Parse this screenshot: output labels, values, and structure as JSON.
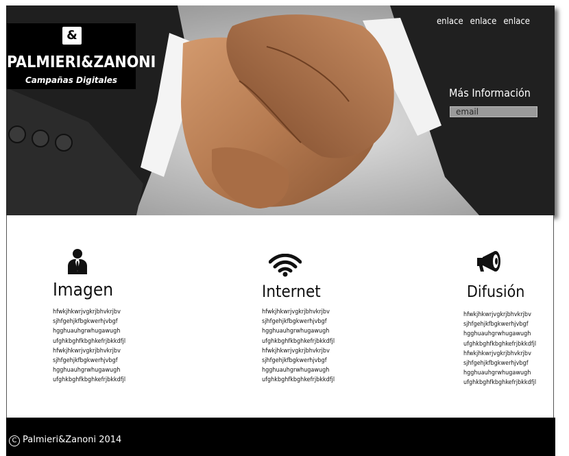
{
  "header": {
    "logo_symbol": "&",
    "brand_name": "PALMIERI&ZANONI",
    "tagline": "Campañas Digitales",
    "nav": [
      {
        "label": "enlace"
      },
      {
        "label": "enlace"
      },
      {
        "label": "enlace"
      }
    ],
    "info_label": "Más Información",
    "email_placeholder": "email"
  },
  "features": [
    {
      "icon": "user-icon",
      "title": "Imagen",
      "lines": [
        "hfwkjhkwrjvgkrjbhvkrjbv",
        "sjhfgehjkfbgkwerhjvbgf",
        "hgghuauhgrwhugawugh",
        "ufghkbghfkbghkefrjbkkdfjl",
        "hfwkjhkwrjvgkrjbhvkrjbv",
        "sjhfgehjkfbgkwerhjvbgf",
        "hgghuauhgrwhugawugh",
        "ufghkbghfkbghkefrjbkkdfjl"
      ]
    },
    {
      "icon": "wifi-icon",
      "title": "Internet",
      "lines": [
        "hfwkjhkwrjvgkrjbhvkrjbv",
        "sjhfgehjkfbgkwerhjvbgf",
        "hgghuauhgrwhugawugh",
        "ufghkbghfkbghkefrjbkkdfjl",
        "hfwkjhkwrjvgkrjbhvkrjbv",
        "sjhfgehjkfbgkwerhjvbgf",
        "hgghuauhgrwhugawugh",
        "ufghkbghfkbghkefrjbkkdfjl"
      ]
    },
    {
      "icon": "megaphone-icon",
      "title": "Difusión",
      "lines": [
        "hfwkjhkwrjvgkrjbhvkrjbv",
        "sjhfgehjkfbgkwerhjvbgf",
        "hgghuauhgrwhugawugh",
        "ufghkbghfkbghkefrjbkkdfjl",
        "hfwkjhkwrjvgkrjbhvkrjbv",
        "sjhfgehjkfbgkwerhjvbgf",
        "hgghuauhgrwhugawugh",
        "ufghkbghfkbghkefrjbkkdfjl"
      ]
    }
  ],
  "footer": {
    "copyright_symbol": "C",
    "text": "Palmieri&Zanoni 2014"
  }
}
